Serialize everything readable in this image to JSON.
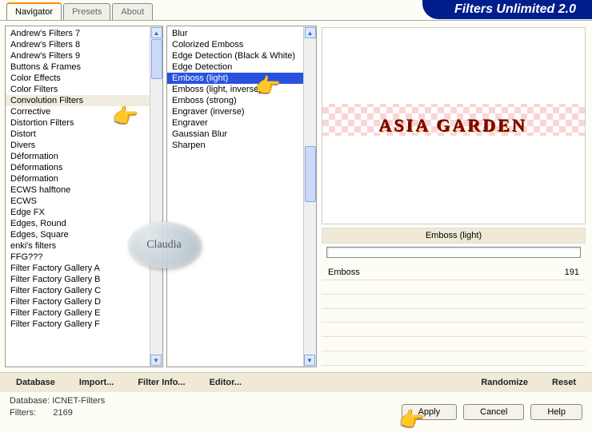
{
  "header": {
    "title": "Filters Unlimited 2.0",
    "tabs": [
      {
        "label": "Navigator",
        "active": true
      },
      {
        "label": "Presets",
        "active": false
      },
      {
        "label": "About",
        "active": false
      }
    ]
  },
  "categories": {
    "selected": "Convolution Filters",
    "items": [
      "Andrew's Filters 7",
      "Andrew's Filters 8",
      "Andrew's Filters 9",
      "Buttons & Frames",
      "Color Effects",
      "Color Filters",
      "Convolution Filters",
      "Corrective",
      "Distortion Filters",
      "Distort",
      "Divers",
      "Déformation",
      "Déformations",
      "Déformation",
      "ECWS halftone",
      "ECWS",
      "Edge FX",
      "Edges, Round",
      "Edges, Square",
      "enki's filters",
      "FFG???",
      "Filter Factory Gallery A",
      "Filter Factory Gallery B",
      "Filter Factory Gallery C",
      "Filter Factory Gallery D",
      "Filter Factory Gallery E",
      "Filter Factory Gallery F"
    ]
  },
  "filters": {
    "selected": "Emboss (light)",
    "items": [
      "Blur",
      "Colorized Emboss",
      "Edge Detection (Black & White)",
      "Edge Detection",
      "Emboss (light)",
      "Emboss (light, inverse)",
      "Emboss (strong)",
      "Engraver (inverse)",
      "Engraver",
      "Gaussian Blur",
      "Sharpen"
    ]
  },
  "preview": {
    "image_text": "ASIA GARDEN",
    "filter_label": "Emboss (light)"
  },
  "params": [
    {
      "name": "Emboss",
      "value": "191"
    }
  ],
  "toolbar": {
    "database": "Database",
    "import": "Import...",
    "filter_info": "Filter Info...",
    "editor": "Editor...",
    "randomize": "Randomize",
    "reset": "Reset"
  },
  "footer": {
    "db_label": "Database:",
    "db_value": "ICNET-Filters",
    "filters_label": "Filters:",
    "filters_value": "2169",
    "apply": "Apply",
    "cancel": "Cancel",
    "help": "Help"
  },
  "watermark": "Claudia"
}
